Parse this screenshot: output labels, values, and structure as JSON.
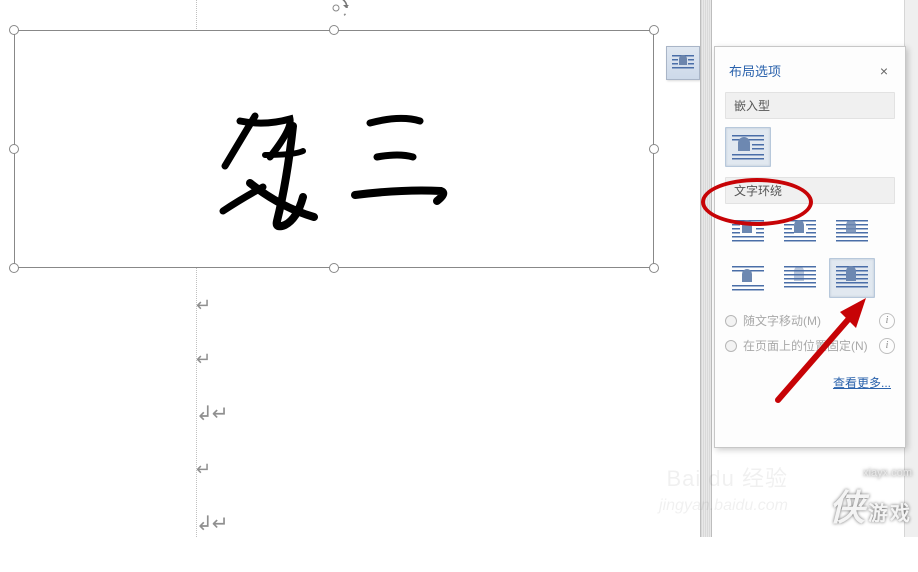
{
  "trigger_icon": "layout-options-icon",
  "panel": {
    "title": "布局选项",
    "close": "×",
    "section_inline": "嵌入型",
    "section_wrap": "文字环绕",
    "options_inline": [
      {
        "name": "inline-with-text",
        "selected": true
      }
    ],
    "options_wrap": [
      {
        "name": "square"
      },
      {
        "name": "tight"
      },
      {
        "name": "through"
      },
      {
        "name": "top-and-bottom"
      },
      {
        "name": "behind-text"
      },
      {
        "name": "in-front-of-text",
        "selected": true
      }
    ],
    "radio1": "随文字移动(M)",
    "radio2": "在页面上的位置固定(N)",
    "see_more": "查看更多..."
  },
  "signature_text": "张三",
  "paragraph_marks": [
    "↵",
    "↵",
    "↲↵",
    "↵",
    "↲↵"
  ],
  "watermark": {
    "url": "xiayx.com",
    "brand_left": "侠",
    "brand_right": "游戏",
    "baidu": "Bai du 经验",
    "jing": "jingyan.baidu.com"
  }
}
